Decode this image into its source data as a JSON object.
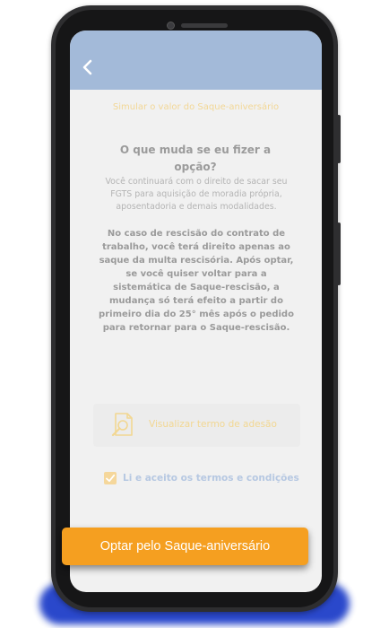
{
  "screen": {
    "simulate_link": "Simular o valor do Saque-aniversário",
    "question": "O que muda se eu fizer a opção?",
    "body_text": "Você continuará com o direito de sacar seu FGTS para aquisição de moradia própria, aposentadoria e demais modalidades.",
    "bold_text": "No caso de rescisão do contrato de trabalho, você terá direito apenas ao saque da multa rescisória. Após optar, se você quiser voltar para a sistemática de Saque-rescisão, a mudança só terá efeito a partir do primeiro dia do 25° mês após o pedido para retornar para o Saque-rescisão.",
    "term_button": "Visualizar termo de adesão",
    "checkbox_label": "Li e aceito os termos e condições",
    "checkbox_checked": true,
    "cta_button": "Optar pelo Saque-aniversário"
  },
  "icons": {
    "back": "chevron-left-icon",
    "document": "document-search-icon",
    "check": "checkmark-icon"
  },
  "colors": {
    "header": "#a3bad9",
    "accent": "#f59f20",
    "device_glow": "#1f3fc9"
  }
}
